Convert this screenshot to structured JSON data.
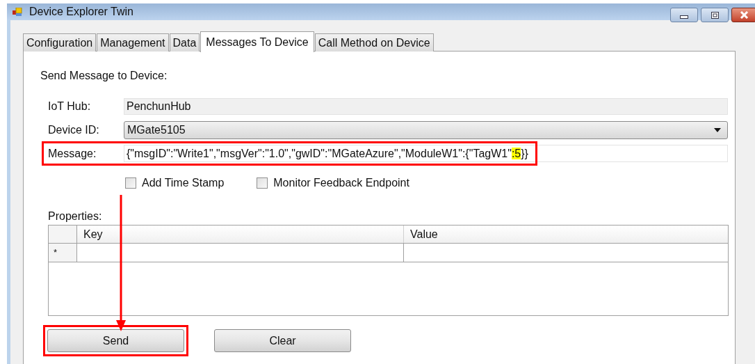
{
  "window": {
    "title": "Device Explorer Twin"
  },
  "tabs": [
    {
      "label": "Configuration",
      "selected": false
    },
    {
      "label": "Management",
      "selected": false
    },
    {
      "label": "Data",
      "selected": false
    },
    {
      "label": "Messages To Device",
      "selected": true
    },
    {
      "label": "Call Method on Device",
      "selected": false
    }
  ],
  "section_title": "Send Message to Device:",
  "fields": [
    {
      "kind": "readonly",
      "label": "IoT Hub:",
      "value": "PenchunHub",
      "annotated": false
    },
    {
      "kind": "dropdown",
      "label": "Device ID:",
      "value": "MGate5105",
      "annotated": false
    },
    {
      "kind": "text",
      "label": "Message:",
      "annotated": true,
      "segments": [
        {
          "text": "{\"msgID\":\"Write1\",\"msgVer\":\"1.0\",\"gwID\":\"MGateAzure\",\"ModuleW1\":{\"TagW1\"",
          "highlighted": false
        },
        {
          "text": ":5",
          "highlighted": true
        },
        {
          "text": "}}",
          "highlighted": false
        }
      ]
    }
  ],
  "checkboxes": [
    {
      "label": "Add Time Stamp",
      "checked": false
    },
    {
      "label": "Monitor Feedback Endpoint",
      "checked": false
    }
  ],
  "properties": {
    "label": "Properties:",
    "columns": [
      "Key",
      "Value"
    ],
    "new_row_marker": "*"
  },
  "buttons": [
    {
      "label": "Send",
      "annotated": true
    },
    {
      "label": "Clear",
      "annotated": false
    }
  ]
}
